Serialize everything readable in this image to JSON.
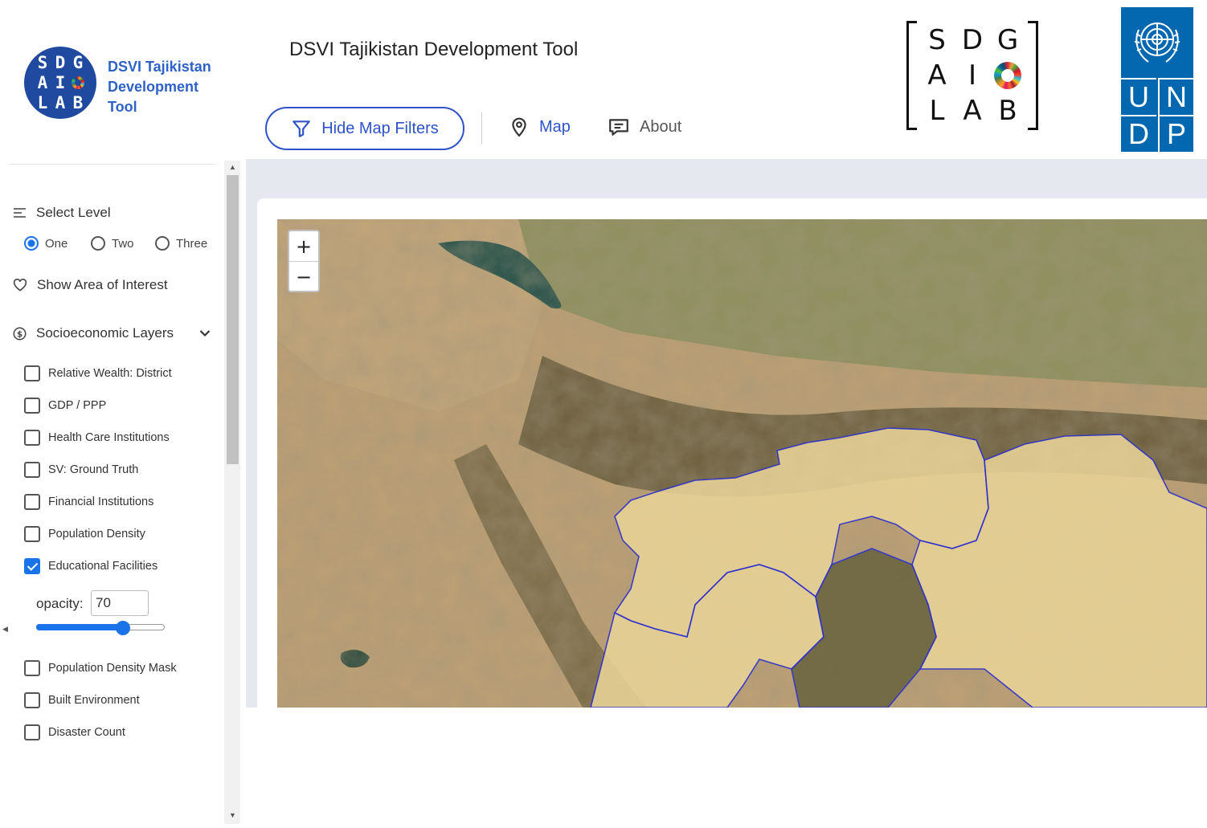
{
  "header": {
    "brand": {
      "logo_letters": [
        "S",
        "D",
        "G",
        "A",
        "I",
        "",
        "L",
        "A",
        "B"
      ],
      "name": "DSVI Tajikistan Development Tool"
    },
    "title": "DSVI Tajikistan Development Tool",
    "filter_button": {
      "label": "Hide Map Filters",
      "icon": "filter-icon"
    },
    "nav": [
      {
        "label": "Map",
        "icon": "map-pin-icon"
      },
      {
        "label": "About",
        "icon": "message-icon"
      }
    ],
    "sdg_logo": [
      "S",
      "D",
      "G",
      "A",
      "I",
      "",
      "L",
      "A",
      "B"
    ],
    "undp_logo": [
      "U",
      "N",
      "D",
      "P"
    ]
  },
  "sidebar": {
    "level": {
      "label": "Select Level",
      "options": [
        "One",
        "Two",
        "Three"
      ],
      "selected": "One"
    },
    "area_of_interest": {
      "label": "Show Area of Interest"
    },
    "socio": {
      "label": "Socioeconomic Layers",
      "layers": [
        {
          "label": "Relative Wealth: District",
          "checked": false
        },
        {
          "label": "GDP / PPP",
          "checked": false
        },
        {
          "label": "Health Care Institutions",
          "checked": false
        },
        {
          "label": "SV: Ground Truth",
          "checked": false
        },
        {
          "label": "Financial Institutions",
          "checked": false
        },
        {
          "label": "Population Density",
          "checked": false
        },
        {
          "label": "Educational Facilities",
          "checked": true
        },
        {
          "label": "Population Density Mask",
          "checked": false
        },
        {
          "label": "Built Environment",
          "checked": false
        },
        {
          "label": "Disaster Count",
          "checked": false
        }
      ],
      "opacity": {
        "label": "opacity:",
        "value": "70",
        "fraction": 0.7
      }
    }
  },
  "map": {
    "zoom_in": "+",
    "zoom_out": "−",
    "colors": {
      "region_fill": "#e8d397",
      "region_border": "#2b2fd1",
      "mountains": "#5d5233",
      "vegetation": "#6f7a48",
      "water": "#1f4d46"
    }
  }
}
